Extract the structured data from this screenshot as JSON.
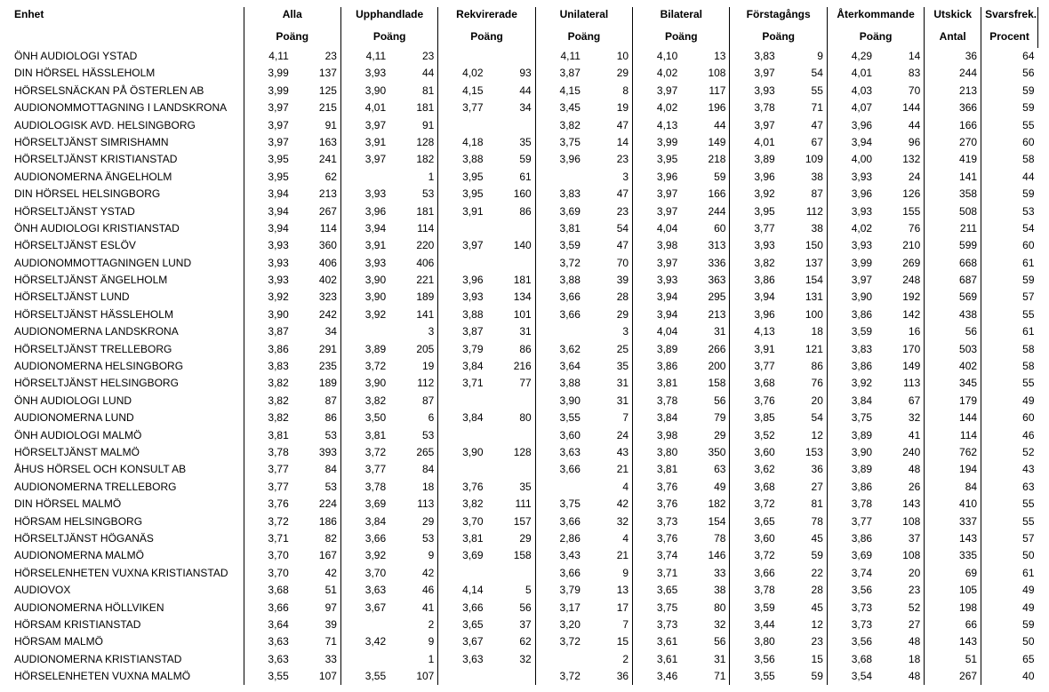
{
  "headers": {
    "enhet": "Enhet",
    "groups": [
      "Alla",
      "Upphandlade",
      "Rekvirerade",
      "Unilateral",
      "Bilateral",
      "Förstagångs",
      "Återkommande"
    ],
    "sub": "Poäng",
    "utskick": "Utskick",
    "svarsfrek": "Svarsfrek.",
    "antal": "Antal",
    "procent": "Procent"
  },
  "rows": [
    {
      "n": "ÖNH AUDIOLOGI YSTAD",
      "v": [
        "4,11",
        "23",
        "4,11",
        "23",
        "",
        "",
        "4,11",
        "10",
        "4,10",
        "13",
        "3,83",
        "9",
        "4,29",
        "14",
        "36",
        "64"
      ]
    },
    {
      "n": "DIN HÖRSEL HÄSSLEHOLM",
      "v": [
        "3,99",
        "137",
        "3,93",
        "44",
        "4,02",
        "93",
        "3,87",
        "29",
        "4,02",
        "108",
        "3,97",
        "54",
        "4,01",
        "83",
        "244",
        "56"
      ]
    },
    {
      "n": "HÖRSELSNÄCKAN PÅ ÖSTERLEN AB",
      "v": [
        "3,99",
        "125",
        "3,90",
        "81",
        "4,15",
        "44",
        "4,15",
        "8",
        "3,97",
        "117",
        "3,93",
        "55",
        "4,03",
        "70",
        "213",
        "59"
      ]
    },
    {
      "n": "AUDIONOMMOTTAGNING I LANDSKRONA",
      "v": [
        "3,97",
        "215",
        "4,01",
        "181",
        "3,77",
        "34",
        "3,45",
        "19",
        "4,02",
        "196",
        "3,78",
        "71",
        "4,07",
        "144",
        "366",
        "59"
      ]
    },
    {
      "n": "AUDIOLOGISK AVD. HELSINGBORG",
      "v": [
        "3,97",
        "91",
        "3,97",
        "91",
        "",
        "",
        "3,82",
        "47",
        "4,13",
        "44",
        "3,97",
        "47",
        "3,96",
        "44",
        "166",
        "55"
      ]
    },
    {
      "n": "HÖRSELTJÄNST SIMRISHAMN",
      "v": [
        "3,97",
        "163",
        "3,91",
        "128",
        "4,18",
        "35",
        "3,75",
        "14",
        "3,99",
        "149",
        "4,01",
        "67",
        "3,94",
        "96",
        "270",
        "60"
      ]
    },
    {
      "n": "HÖRSELTJÄNST KRISTIANSTAD",
      "v": [
        "3,95",
        "241",
        "3,97",
        "182",
        "3,88",
        "59",
        "3,96",
        "23",
        "3,95",
        "218",
        "3,89",
        "109",
        "4,00",
        "132",
        "419",
        "58"
      ]
    },
    {
      "n": "AUDIONOMERNA ÄNGELHOLM",
      "v": [
        "3,95",
        "62",
        "",
        "1",
        "3,95",
        "61",
        "",
        "3",
        "3,96",
        "59",
        "3,96",
        "38",
        "3,93",
        "24",
        "141",
        "44"
      ]
    },
    {
      "n": "DIN HÖRSEL HELSINGBORG",
      "v": [
        "3,94",
        "213",
        "3,93",
        "53",
        "3,95",
        "160",
        "3,83",
        "47",
        "3,97",
        "166",
        "3,92",
        "87",
        "3,96",
        "126",
        "358",
        "59"
      ]
    },
    {
      "n": "HÖRSELTJÄNST YSTAD",
      "v": [
        "3,94",
        "267",
        "3,96",
        "181",
        "3,91",
        "86",
        "3,69",
        "23",
        "3,97",
        "244",
        "3,95",
        "112",
        "3,93",
        "155",
        "508",
        "53"
      ]
    },
    {
      "n": "ÖNH AUDIOLOGI KRISTIANSTAD",
      "v": [
        "3,94",
        "114",
        "3,94",
        "114",
        "",
        "",
        "3,81",
        "54",
        "4,04",
        "60",
        "3,77",
        "38",
        "4,02",
        "76",
        "211",
        "54"
      ]
    },
    {
      "n": "HÖRSELTJÄNST ESLÖV",
      "v": [
        "3,93",
        "360",
        "3,91",
        "220",
        "3,97",
        "140",
        "3,59",
        "47",
        "3,98",
        "313",
        "3,93",
        "150",
        "3,93",
        "210",
        "599",
        "60"
      ]
    },
    {
      "n": "AUDIONOMMOTTAGNINGEN LUND",
      "v": [
        "3,93",
        "406",
        "3,93",
        "406",
        "",
        "",
        "3,72",
        "70",
        "3,97",
        "336",
        "3,82",
        "137",
        "3,99",
        "269",
        "668",
        "61"
      ]
    },
    {
      "n": "HÖRSELTJÄNST ÄNGELHOLM",
      "v": [
        "3,93",
        "402",
        "3,90",
        "221",
        "3,96",
        "181",
        "3,88",
        "39",
        "3,93",
        "363",
        "3,86",
        "154",
        "3,97",
        "248",
        "687",
        "59"
      ]
    },
    {
      "n": "HÖRSELTJÄNST LUND",
      "v": [
        "3,92",
        "323",
        "3,90",
        "189",
        "3,93",
        "134",
        "3,66",
        "28",
        "3,94",
        "295",
        "3,94",
        "131",
        "3,90",
        "192",
        "569",
        "57"
      ]
    },
    {
      "n": "HÖRSELTJÄNST HÄSSLEHOLM",
      "v": [
        "3,90",
        "242",
        "3,92",
        "141",
        "3,88",
        "101",
        "3,66",
        "29",
        "3,94",
        "213",
        "3,96",
        "100",
        "3,86",
        "142",
        "438",
        "55"
      ]
    },
    {
      "n": "AUDIONOMERNA LANDSKRONA",
      "v": [
        "3,87",
        "34",
        "",
        "3",
        "3,87",
        "31",
        "",
        "3",
        "4,04",
        "31",
        "4,13",
        "18",
        "3,59",
        "16",
        "56",
        "61"
      ]
    },
    {
      "n": "HÖRSELTJÄNST TRELLEBORG",
      "v": [
        "3,86",
        "291",
        "3,89",
        "205",
        "3,79",
        "86",
        "3,62",
        "25",
        "3,89",
        "266",
        "3,91",
        "121",
        "3,83",
        "170",
        "503",
        "58"
      ]
    },
    {
      "n": "AUDIONOMERNA HELSINGBORG",
      "v": [
        "3,83",
        "235",
        "3,72",
        "19",
        "3,84",
        "216",
        "3,64",
        "35",
        "3,86",
        "200",
        "3,77",
        "86",
        "3,86",
        "149",
        "402",
        "58"
      ]
    },
    {
      "n": "HÖRSELTJÄNST HELSINGBORG",
      "v": [
        "3,82",
        "189",
        "3,90",
        "112",
        "3,71",
        "77",
        "3,88",
        "31",
        "3,81",
        "158",
        "3,68",
        "76",
        "3,92",
        "113",
        "345",
        "55"
      ]
    },
    {
      "n": "ÖNH AUDIOLOGI LUND",
      "v": [
        "3,82",
        "87",
        "3,82",
        "87",
        "",
        "",
        "3,90",
        "31",
        "3,78",
        "56",
        "3,76",
        "20",
        "3,84",
        "67",
        "179",
        "49"
      ]
    },
    {
      "n": "AUDIONOMERNA LUND",
      "v": [
        "3,82",
        "86",
        "3,50",
        "6",
        "3,84",
        "80",
        "3,55",
        "7",
        "3,84",
        "79",
        "3,85",
        "54",
        "3,75",
        "32",
        "144",
        "60"
      ]
    },
    {
      "n": "ÖNH AUDIOLOGI MALMÖ",
      "v": [
        "3,81",
        "53",
        "3,81",
        "53",
        "",
        "",
        "3,60",
        "24",
        "3,98",
        "29",
        "3,52",
        "12",
        "3,89",
        "41",
        "114",
        "46"
      ]
    },
    {
      "n": "HÖRSELTJÄNST MALMÖ",
      "v": [
        "3,78",
        "393",
        "3,72",
        "265",
        "3,90",
        "128",
        "3,63",
        "43",
        "3,80",
        "350",
        "3,60",
        "153",
        "3,90",
        "240",
        "762",
        "52"
      ]
    },
    {
      "n": "ÅHUS HÖRSEL OCH KONSULT AB",
      "v": [
        "3,77",
        "84",
        "3,77",
        "84",
        "",
        "",
        "3,66",
        "21",
        "3,81",
        "63",
        "3,62",
        "36",
        "3,89",
        "48",
        "194",
        "43"
      ]
    },
    {
      "n": "AUDIONOMERNA TRELLEBORG",
      "v": [
        "3,77",
        "53",
        "3,78",
        "18",
        "3,76",
        "35",
        "",
        "4",
        "3,76",
        "49",
        "3,68",
        "27",
        "3,86",
        "26",
        "84",
        "63"
      ]
    },
    {
      "n": "DIN HÖRSEL MALMÖ",
      "v": [
        "3,76",
        "224",
        "3,69",
        "113",
        "3,82",
        "111",
        "3,75",
        "42",
        "3,76",
        "182",
        "3,72",
        "81",
        "3,78",
        "143",
        "410",
        "55"
      ]
    },
    {
      "n": "HÖRSAM HELSINGBORG",
      "v": [
        "3,72",
        "186",
        "3,84",
        "29",
        "3,70",
        "157",
        "3,66",
        "32",
        "3,73",
        "154",
        "3,65",
        "78",
        "3,77",
        "108",
        "337",
        "55"
      ]
    },
    {
      "n": "HÖRSELTJÄNST HÖGANÄS",
      "v": [
        "3,71",
        "82",
        "3,66",
        "53",
        "3,81",
        "29",
        "2,86",
        "4",
        "3,76",
        "78",
        "3,60",
        "45",
        "3,86",
        "37",
        "143",
        "57"
      ]
    },
    {
      "n": "AUDIONOMERNA MALMÖ",
      "v": [
        "3,70",
        "167",
        "3,92",
        "9",
        "3,69",
        "158",
        "3,43",
        "21",
        "3,74",
        "146",
        "3,72",
        "59",
        "3,69",
        "108",
        "335",
        "50"
      ]
    },
    {
      "n": "HÖRSELENHETEN VUXNA KRISTIANSTAD",
      "v": [
        "3,70",
        "42",
        "3,70",
        "42",
        "",
        "",
        "3,66",
        "9",
        "3,71",
        "33",
        "3,66",
        "22",
        "3,74",
        "20",
        "69",
        "61"
      ]
    },
    {
      "n": "AUDIOVOX",
      "v": [
        "3,68",
        "51",
        "3,63",
        "46",
        "4,14",
        "5",
        "3,79",
        "13",
        "3,65",
        "38",
        "3,78",
        "28",
        "3,56",
        "23",
        "105",
        "49"
      ]
    },
    {
      "n": "AUDIONOMERNA HÖLLVIKEN",
      "v": [
        "3,66",
        "97",
        "3,67",
        "41",
        "3,66",
        "56",
        "3,17",
        "17",
        "3,75",
        "80",
        "3,59",
        "45",
        "3,73",
        "52",
        "198",
        "49"
      ]
    },
    {
      "n": "HÖRSAM KRISTIANSTAD",
      "v": [
        "3,64",
        "39",
        "",
        "2",
        "3,65",
        "37",
        "3,20",
        "7",
        "3,73",
        "32",
        "3,44",
        "12",
        "3,73",
        "27",
        "66",
        "59"
      ]
    },
    {
      "n": "HÖRSAM MALMÖ",
      "v": [
        "3,63",
        "71",
        "3,42",
        "9",
        "3,67",
        "62",
        "3,72",
        "15",
        "3,61",
        "56",
        "3,80",
        "23",
        "3,56",
        "48",
        "143",
        "50"
      ]
    },
    {
      "n": "AUDIONOMERNA KRISTIANSTAD",
      "v": [
        "3,63",
        "33",
        "",
        "1",
        "3,63",
        "32",
        "",
        "2",
        "3,61",
        "31",
        "3,56",
        "15",
        "3,68",
        "18",
        "51",
        "65"
      ]
    },
    {
      "n": "HÖRSELENHETEN VUXNA MALMÖ",
      "v": [
        "3,55",
        "107",
        "3,55",
        "107",
        "",
        "",
        "3,72",
        "36",
        "3,46",
        "71",
        "3,55",
        "59",
        "3,54",
        "48",
        "267",
        "40"
      ]
    }
  ]
}
